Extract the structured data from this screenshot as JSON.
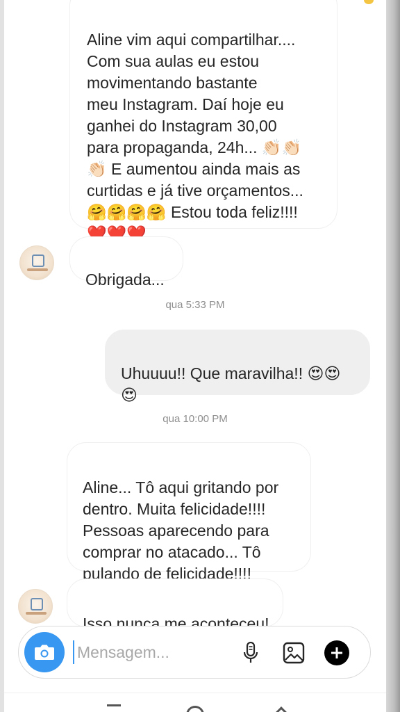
{
  "conversation": {
    "messages": [
      {
        "id": "m1",
        "direction": "incoming",
        "text": "Aline vim aqui compartilhar....\nCom sua aulas eu estou\nmovimentando bastante\nmeu Instagram. Daí hoje eu\nganhei do Instagram 30,00\npara propaganda, 24h... 👏🏻👏🏻\n👏🏻 E aumentou ainda mais as\ncurtidas e já tive orçamentos...\n🤗🤗🤗🤗 Estou toda feliz!!!!\n❤️❤️❤️"
      },
      {
        "id": "m2",
        "direction": "incoming",
        "text": "Obrigada..."
      },
      {
        "id": "m3",
        "direction": "outgoing",
        "text": "Uhuuuu!! Que maravilha!! 😍😍\n😍"
      },
      {
        "id": "m4",
        "direction": "incoming",
        "text": "Aline... Tô aqui gritando por\ndentro. Muita felicidade!!!!\nPessoas aparecendo para\ncomprar no atacado... Tô\npulando de felicidade!!!!"
      },
      {
        "id": "m5",
        "direction": "incoming",
        "text": "Isso nunca me aconteceu!"
      }
    ],
    "timestamps": [
      "qua 5:33 PM",
      "qua 10:00 PM"
    ]
  },
  "composer": {
    "placeholder": "Mensagem...",
    "camera_icon": "camera-icon",
    "mic_icon": "microphone-icon",
    "gallery_icon": "gallery-icon",
    "add_icon": "plus-circle-icon"
  },
  "colors": {
    "accent": "#3897f0",
    "outgoing_bubble": "#efefef",
    "timestamp": "#8e8e8e"
  }
}
